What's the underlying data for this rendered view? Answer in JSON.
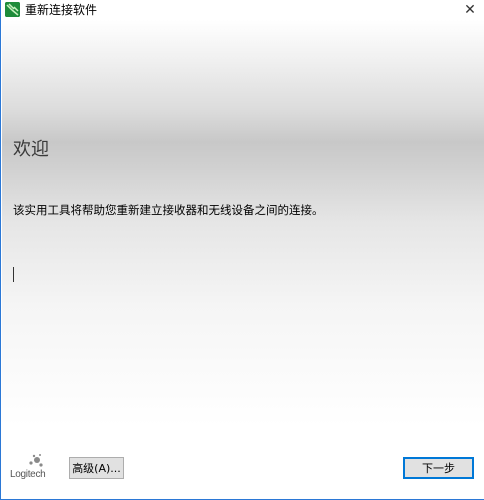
{
  "window": {
    "title": "重新连接软件",
    "close_glyph": "✕"
  },
  "content": {
    "heading": "欢迎",
    "description": "该实用工具将帮助您重新建立接收器和无线设备之间的连接。"
  },
  "footer": {
    "brand": "Logitech",
    "advanced_label": "高级(A)...",
    "next_label": "下一步"
  },
  "colors": {
    "accent": "#0078d7",
    "window_border": "#2b78d6",
    "button_bg": "#e1e1e1"
  }
}
